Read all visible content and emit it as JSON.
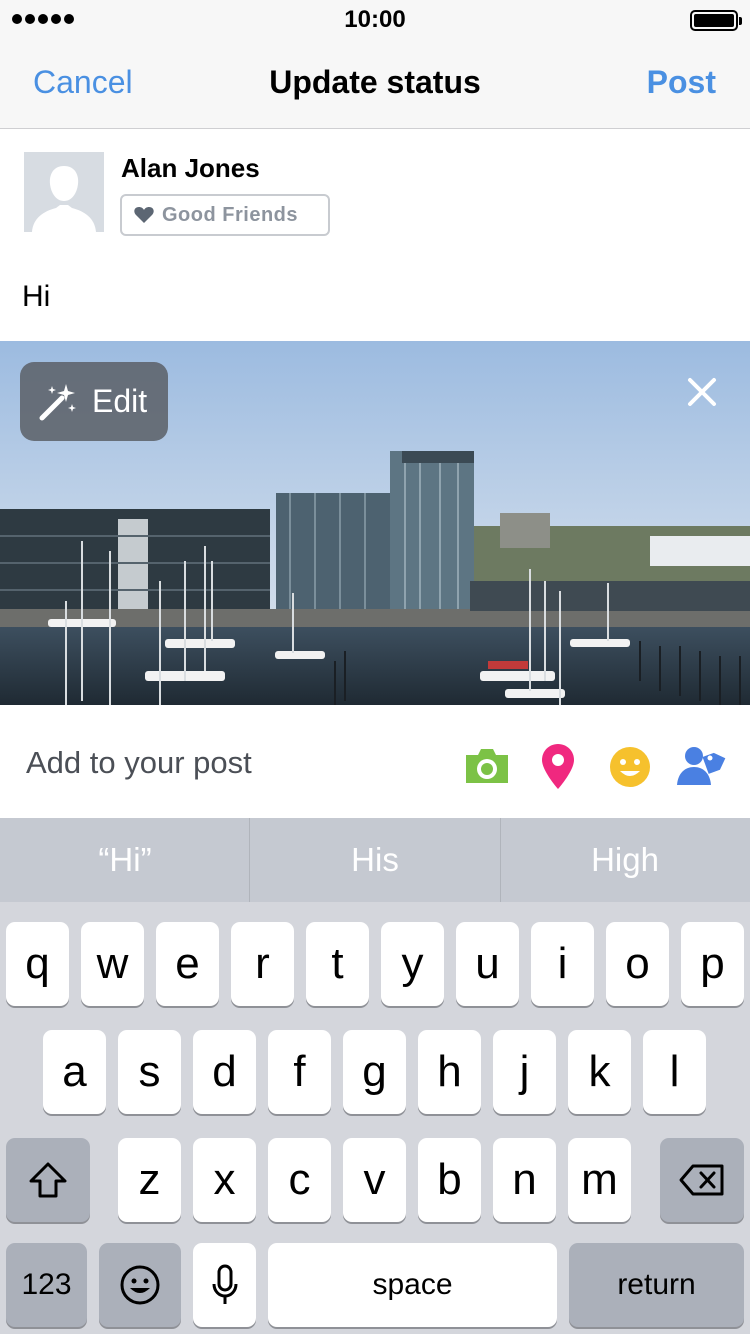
{
  "status_bar": {
    "time": "10:00"
  },
  "nav": {
    "cancel_label": "Cancel",
    "title": "Update status",
    "post_label": "Post"
  },
  "composer": {
    "user_name": "Alan Jones",
    "audience_label": "Good Friends",
    "audience_icon": "heart-icon",
    "text": "Hi"
  },
  "photo": {
    "edit_label": "Edit",
    "edit_icon": "magic-wand-icon",
    "close_icon": "close-icon"
  },
  "add_to_post": {
    "label": "Add to your post",
    "icons": [
      {
        "name": "camera-icon",
        "color": "#7cc246"
      },
      {
        "name": "location-pin-icon",
        "color": "#f0287f"
      },
      {
        "name": "smiley-icon",
        "color": "#f6c12d"
      },
      {
        "name": "tag-people-icon",
        "color": "#4a80e2"
      }
    ]
  },
  "suggestions": [
    "“Hi”",
    "His",
    "High"
  ],
  "keyboard": {
    "row1": [
      "q",
      "w",
      "e",
      "r",
      "t",
      "y",
      "u",
      "i",
      "o",
      "p"
    ],
    "row2": [
      "a",
      "s",
      "d",
      "f",
      "g",
      "h",
      "j",
      "k",
      "l"
    ],
    "row3": [
      "z",
      "x",
      "c",
      "v",
      "b",
      "n",
      "m"
    ],
    "numbers_label": "123",
    "space_label": "space",
    "return_label": "return"
  }
}
